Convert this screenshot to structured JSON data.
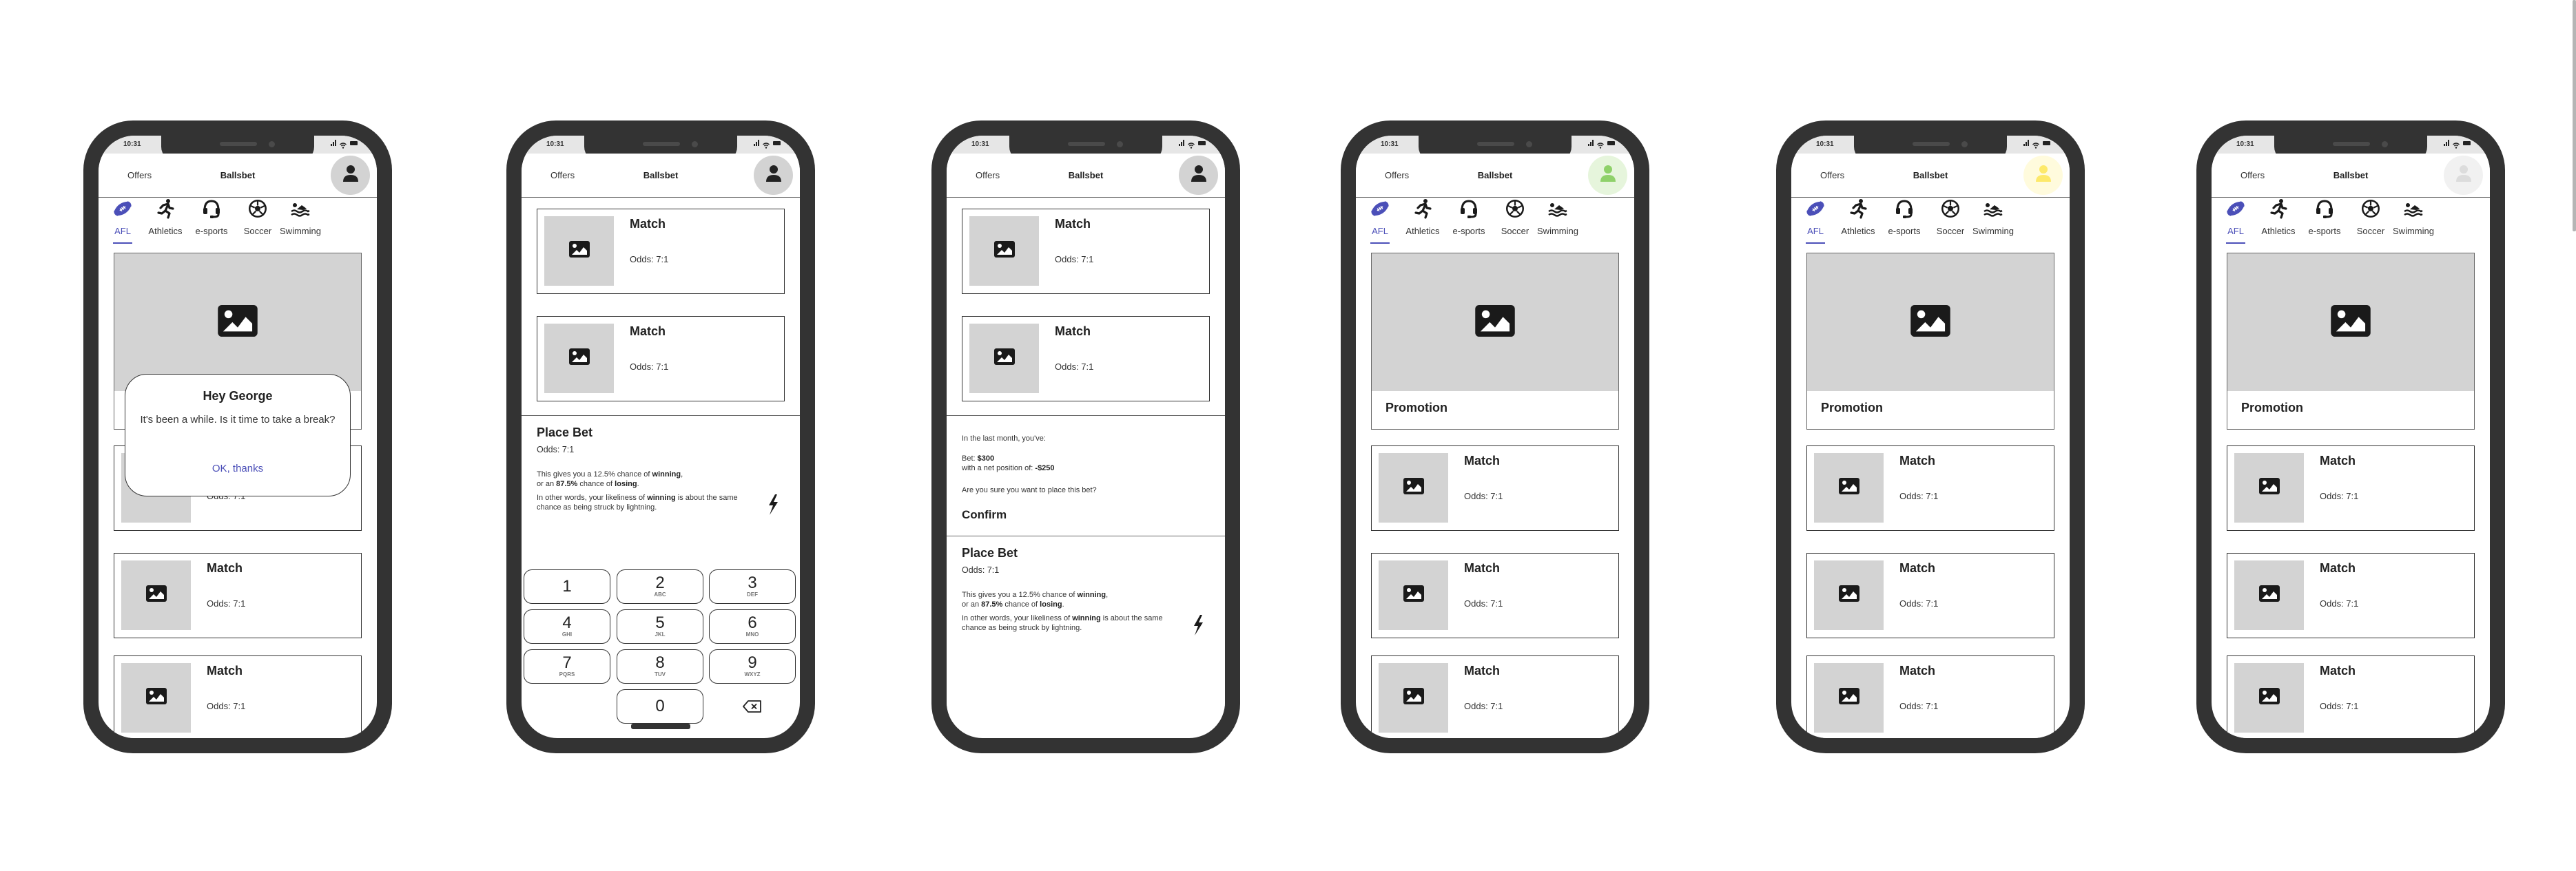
{
  "status_time": "10:31",
  "app": {
    "offers_label": "Offers",
    "brand": "Ballsbet"
  },
  "colors": {
    "accent": "#4b4fb8",
    "frame": "#333333",
    "placeholder": "#d3d3d3",
    "avatar_default_bg": "#d3d3d3",
    "avatar_default_fg": "#222222",
    "avatar_green_bg": "#e6f5dc",
    "avatar_green_fg": "#8fd16a",
    "avatar_yellow_bg": "#fffbdd",
    "avatar_yellow_fg": "#fde96a",
    "avatar_grey_bg": "#f1f1f1",
    "avatar_grey_fg": "#dcdcdc"
  },
  "tabs": [
    {
      "label": "AFL",
      "icon": "football-icon",
      "active": true
    },
    {
      "label": "Athletics",
      "icon": "running-icon",
      "active": false
    },
    {
      "label": "e-sports",
      "icon": "headset-icon",
      "active": false
    },
    {
      "label": "Soccer",
      "icon": "soccer-ball-icon",
      "active": false
    },
    {
      "label": "Swimming",
      "icon": "swimmer-icon",
      "active": false
    }
  ],
  "promotion_title": "Promotion",
  "match": {
    "title": "Match",
    "odds": "Odds: 7:1"
  },
  "dialog": {
    "title": "Hey George",
    "body": "It's been a while. Is it time to take a break?",
    "button": "OK, thanks"
  },
  "place_bet": {
    "title": "Place Bet",
    "odds": "Odds: 7:1",
    "line1_prefix": "This gives you a 12.5% chance of ",
    "line1_bold": "winning",
    "line1_suffix": ",",
    "line2_prefix": "or an ",
    "line2_bold1": "87.5%",
    "line2_mid": " chance of ",
    "line2_bold2": "losing",
    "line2_suffix": ".",
    "line3_prefix": "In other words, your likeliness of ",
    "line3_bold": "winning",
    "line3_suffix": " is about the same chance as being struck by lightning.",
    "icon": "lightning-icon"
  },
  "keypad": [
    {
      "num": "1",
      "letters": ""
    },
    {
      "num": "2",
      "letters": "ABC"
    },
    {
      "num": "3",
      "letters": "DEF"
    },
    {
      "num": "4",
      "letters": "GHI"
    },
    {
      "num": "5",
      "letters": "JKL"
    },
    {
      "num": "6",
      "letters": "MNO"
    },
    {
      "num": "7",
      "letters": "PQRS"
    },
    {
      "num": "8",
      "letters": "TUV"
    },
    {
      "num": "9",
      "letters": "WXYZ"
    },
    {
      "num": "0",
      "letters": ""
    }
  ],
  "confirm": {
    "intro": "In the last month, you've:",
    "bet_label": "Bet: ",
    "bet_value": "$300",
    "net_label": "with a net position of: ",
    "net_value": "-$250",
    "question": "Are you sure you want to place this bet?",
    "button": "Confirm"
  },
  "phones": [
    {
      "screen": "home-with-dialog",
      "avatar_variant": "default"
    },
    {
      "screen": "place-bet-keypad",
      "avatar_variant": "default"
    },
    {
      "screen": "confirm-bet",
      "avatar_variant": "default"
    },
    {
      "screen": "home",
      "avatar_variant": "green"
    },
    {
      "screen": "home",
      "avatar_variant": "yellow"
    },
    {
      "screen": "home",
      "avatar_variant": "grey"
    }
  ]
}
